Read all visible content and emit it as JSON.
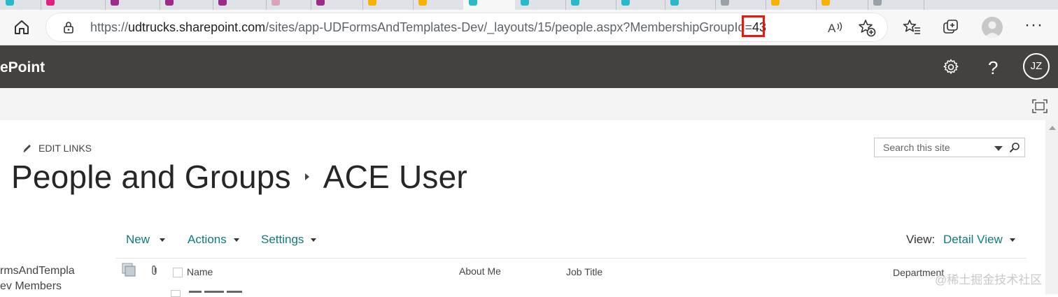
{
  "browser": {
    "url_prefix": "https://",
    "url_host": "udtrucks.sharepoint.com",
    "url_path": "/sites/app-UDFormsAndTemplates-Dev/_layouts/15/people.aspx?MembershipGroupId=",
    "url_id": "43",
    "tab_favicon_colors": [
      "#2bb8c8",
      "#e0207e",
      "#9b2d8a",
      "#9b2d8a",
      "#9b2d8a",
      "#d9a3b8",
      "#9b2d8a",
      "#f4b400",
      "#f4b400",
      "#2bb8c8",
      "#2bb8c8",
      "#2bb8c8",
      "#2bb8c8",
      "#2bb8c8",
      "#9aa0a6",
      "#f4b400",
      "#f4b400",
      "#9aa0a6"
    ],
    "icons": [
      "home-icon",
      "lock-icon",
      "read-aloud-icon",
      "add-favorite-icon",
      "favorites-icon",
      "collections-icon",
      "profile-avatar",
      "more-icon"
    ]
  },
  "suitebar": {
    "brand": "ePoint",
    "avatar_initials": "JZ",
    "icons": [
      "gear-icon",
      "help-icon"
    ]
  },
  "page": {
    "edit_links": "EDIT LINKS",
    "title_parent": "People and Groups",
    "title_current": "ACE User",
    "search_placeholder": "Search this site"
  },
  "leftnav": {
    "items": [
      "rmsAndTempla",
      "ev Members"
    ]
  },
  "toolbar": {
    "new_label": "New",
    "actions_label": "Actions",
    "settings_label": "Settings",
    "view_label": "View:",
    "view_value": "Detail View"
  },
  "table": {
    "columns": [
      "Name",
      "About Me",
      "Job Title",
      "Department"
    ]
  },
  "watermark": "@稀土掘金技术社区",
  "colors": {
    "suitebar_bg": "#444240",
    "link_teal": "#0f7b7b",
    "highlight_red": "#e8190c"
  }
}
